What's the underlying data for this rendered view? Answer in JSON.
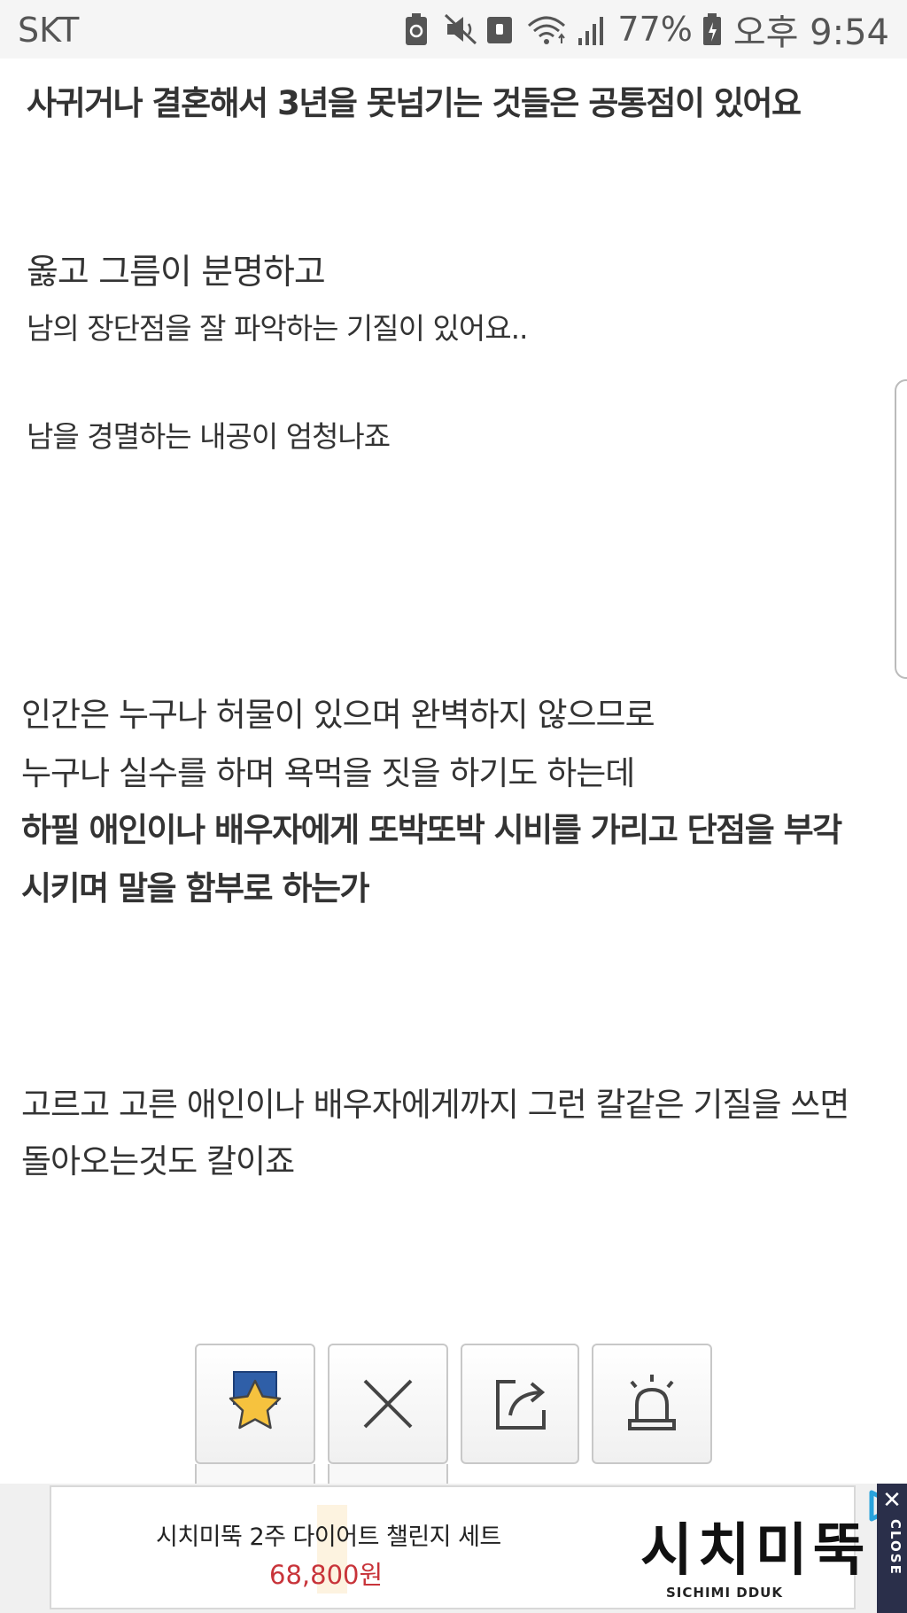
{
  "status_bar": {
    "carrier": "SKT",
    "battery_percent": "77%",
    "time": "오후 9:54"
  },
  "article": {
    "heading": "사귀거나 결혼해서 3년을 못넘기는 것들은 공통점이 있어요",
    "para1_line1": "옳고 그름이 분명하고",
    "para1_line2": "남의 장단점을 잘 파악하는 기질이 있어요..",
    "para2": "남을 경멸하는 내공이 엄청나죠",
    "para3_line1": "인간은 누구나 허물이 있으며 완벽하지 않으므로",
    "para3_line2": "누구나 실수를 하며 욕먹을 짓을 하기도 하는데",
    "para3_bold_line1": "하필 애인이나 배우자에게 또박또박 시비를 가리고 단점을 부각",
    "para3_bold_line2": "시키며 말을 함부로 하는가",
    "para4_line1": "고르고 고른 애인이나 배우자에게까지 그런 칼같은 기질을 쓰면",
    "para4_line2": "돌아오는것도 칼이죠"
  },
  "actions": {
    "buttons": [
      {
        "name": "favorite",
        "icon": "star-icon"
      },
      {
        "name": "close",
        "icon": "x-icon"
      },
      {
        "name": "share",
        "icon": "share-icon"
      },
      {
        "name": "report",
        "icon": "siren-icon"
      }
    ]
  },
  "ad": {
    "title": "시치미뚝 2주 다이어트 챌린지 세트",
    "price": "68,800원",
    "brand_logo": "시치미뚝",
    "brand_sub": "SICHIMI DDUK",
    "close_label": "CLOSE",
    "close_x": "✕"
  },
  "colors": {
    "price_red": "#c8343a",
    "close_bar": "#2a2f4a",
    "star_yellow": "#f6c23e",
    "star_bg_blue": "#2f5fa8"
  }
}
